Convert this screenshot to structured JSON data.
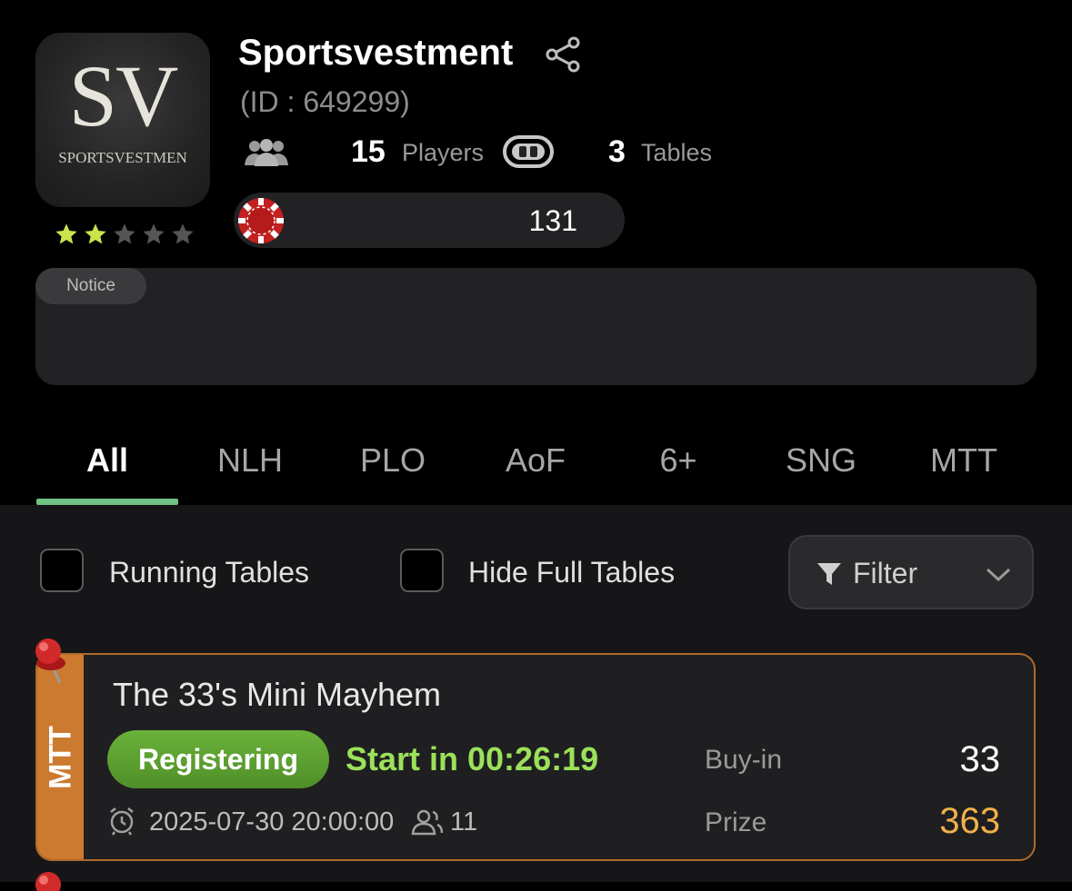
{
  "club": {
    "name": "Sportsvestment",
    "id_text": "(ID : 649299)",
    "logo_text": "SV",
    "logo_subtext": "SPORTSVESTMEN",
    "rating": 2,
    "rating_max": 5,
    "players_count": "15",
    "players_label": "Players",
    "tables_count": "3",
    "tables_label": "Tables",
    "chip_balance": "131"
  },
  "notice": {
    "tag": "Notice",
    "text": ""
  },
  "tabs": [
    {
      "label": "All",
      "active": true
    },
    {
      "label": "NLH",
      "active": false
    },
    {
      "label": "PLO",
      "active": false
    },
    {
      "label": "AoF",
      "active": false
    },
    {
      "label": "6+",
      "active": false
    },
    {
      "label": "SNG",
      "active": false
    },
    {
      "label": "MTT",
      "active": false
    }
  ],
  "filters": {
    "running_tables_label": "Running Tables",
    "running_tables_checked": false,
    "hide_full_label": "Hide Full Tables",
    "hide_full_checked": false,
    "filter_label": "Filter"
  },
  "tournament": {
    "type": "MTT",
    "name": "The 33's Mini Mayhem",
    "status": "Registering",
    "start_in": "Start in 00:26:19",
    "buyin_label": "Buy-in",
    "buyin_value": "33",
    "start_datetime": "2025-07-30 20:00:00",
    "entrants": "11",
    "prize_label": "Prize",
    "prize_value": "363"
  },
  "colors": {
    "accent_green": "#6fc383",
    "status_green": "#5ea232",
    "start_text": "#9be15a",
    "prize": "#f0b04a",
    "mtt_strip": "#cc7a30",
    "star_on": "#c9e44a",
    "star_off": "#555555"
  }
}
